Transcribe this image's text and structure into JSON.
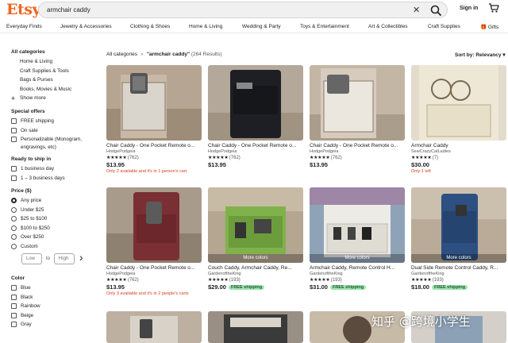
{
  "header": {
    "logo": "Etsy",
    "search_value": "armchair caddy",
    "clear_glyph": "✕",
    "signin": "Sign in"
  },
  "nav": [
    "Everyday Finds",
    "Jewelry & Accessories",
    "Clothing & Shoes",
    "Home & Living",
    "Wedding & Party",
    "Toys & Entertainment",
    "Art & Collectibles",
    "Craft Supplies",
    "🎁 Gifts"
  ],
  "sidebar": {
    "categories_head": "All categories",
    "categories": [
      "Home & Living",
      "Craft Supplies & Tools",
      "Bags & Purses",
      "Books, Movies & Music"
    ],
    "show_more": "Show more",
    "special_head": "Special offers",
    "special": [
      "FREE shipping",
      "On sale",
      "Personalizable (Monogram,",
      "engravings, etc)"
    ],
    "ready_head": "Ready to ship in",
    "ready": [
      "1 business day",
      "1 – 3 business days"
    ],
    "price_head": "Price ($)",
    "price": [
      "Any price",
      "Under $25",
      "$25 to $100",
      "$100 to $250",
      "Over $250",
      "Custom"
    ],
    "low": "Low",
    "to": "to",
    "high": "High",
    "go_glyph": "›",
    "color_head": "Color",
    "colors": [
      "Blue",
      "Black",
      "Rainbow",
      "Beige",
      "Gray"
    ]
  },
  "results": {
    "crumb_all": "All categories",
    "crumb_sep": "›",
    "crumb_query": "\"armchair caddy\"",
    "crumb_count": "(264 Results)",
    "sort_label": "Sort by: Relevancy",
    "sort_glyph": "▾"
  },
  "listings": [
    {
      "title": "Chair Caddy - One Pocket Remote o...",
      "shop": "HodgePodgeia",
      "stars": "★★★★★",
      "reviews": "(762)",
      "price": "$13.95",
      "badge": "",
      "avail": "Only 2 available and it's in 1 person's cart",
      "more_colors": ""
    },
    {
      "title": "Chair Caddy - One Pocket Remote o...",
      "shop": "HodgePodgeia",
      "stars": "★★★★★",
      "reviews": "(762)",
      "price": "$13.95",
      "badge": "",
      "avail": "",
      "more_colors": ""
    },
    {
      "title": "Chair Caddy - One Pocket Remote o...",
      "shop": "HodgePodgeia",
      "stars": "★★★★★",
      "reviews": "(762)",
      "price": "$13.95",
      "badge": "",
      "avail": "",
      "more_colors": ""
    },
    {
      "title": "Armchair Caddy",
      "shop": "SewCrazyCatLadies",
      "stars": "★★★★★",
      "reviews": "(7)",
      "price": "$30.00",
      "badge": "",
      "avail": "Only 1 left",
      "more_colors": ""
    },
    {
      "title": "Chair Caddy - One Pocket Remote o...",
      "shop": "HodgePodgeia",
      "stars": "★★★★★",
      "reviews": "(762)",
      "price": "$13.95",
      "badge": "",
      "avail": "Only 3 available and it's in 2 people's carts",
      "more_colors": ""
    },
    {
      "title": "Couch Caddy, Armchair Caddy, Re...",
      "shop": "GardenoftheKing",
      "stars": "★★★★★",
      "reviews": "(193)",
      "price": "$29.00",
      "badge": "FREE shipping",
      "avail": "",
      "more_colors": "More colors"
    },
    {
      "title": "Armchair Caddy, Remote Control H...",
      "shop": "GardenoftheKing",
      "stars": "★★★★★",
      "reviews": "(193)",
      "price": "$31.00",
      "badge": "FREE shipping",
      "avail": "",
      "more_colors": "More colors"
    },
    {
      "title": "Dual Side Remote Control Caddy, R...",
      "shop": "GardenoftheKing",
      "stars": "★★★★★",
      "reviews": "(193)",
      "price": "$18.00",
      "badge": "FREE shipping",
      "avail": "",
      "more_colors": "More colors"
    }
  ],
  "watermark": "知乎 @跨境小学生",
  "colors": {
    "brand": "#f1641e",
    "avail_red": "#d43d1d",
    "free_ship_bg": "#9ee5b0"
  }
}
